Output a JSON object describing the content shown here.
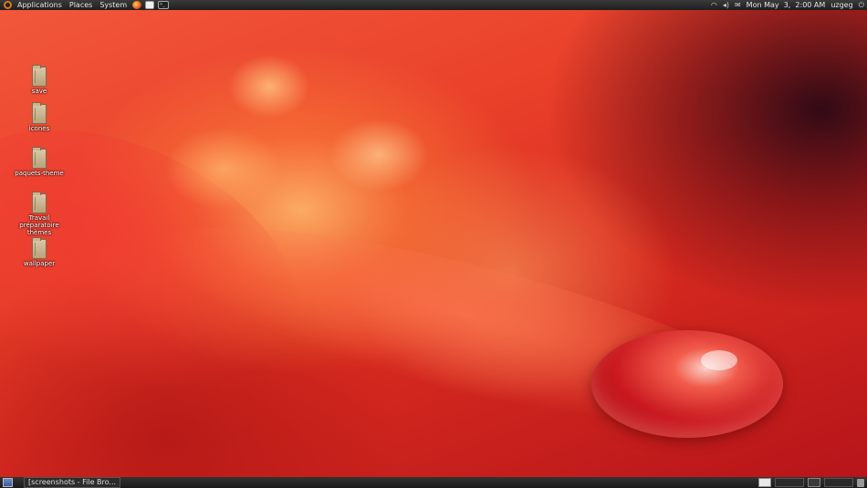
{
  "top_panel": {
    "menus": [
      "Applications",
      "Places",
      "System"
    ],
    "launchers": [
      "firefox-icon",
      "text-editor-icon",
      "terminal-icon"
    ],
    "tray_icons": [
      "wifi-icon",
      "volume-icon",
      "mail-icon"
    ],
    "clock": "Mon May  3,  2:00 AM",
    "user": "uzgeg"
  },
  "desktop": {
    "icons": [
      {
        "label": "save"
      },
      {
        "label": "icones"
      },
      {
        "label": "paquets-theme"
      },
      {
        "label": "Travail préparatoire thèmes"
      },
      {
        "label": "wallpaper"
      }
    ]
  },
  "bottom_panel": {
    "tasks": [
      {
        "label": "[screenshots - File Bro..."
      }
    ]
  }
}
